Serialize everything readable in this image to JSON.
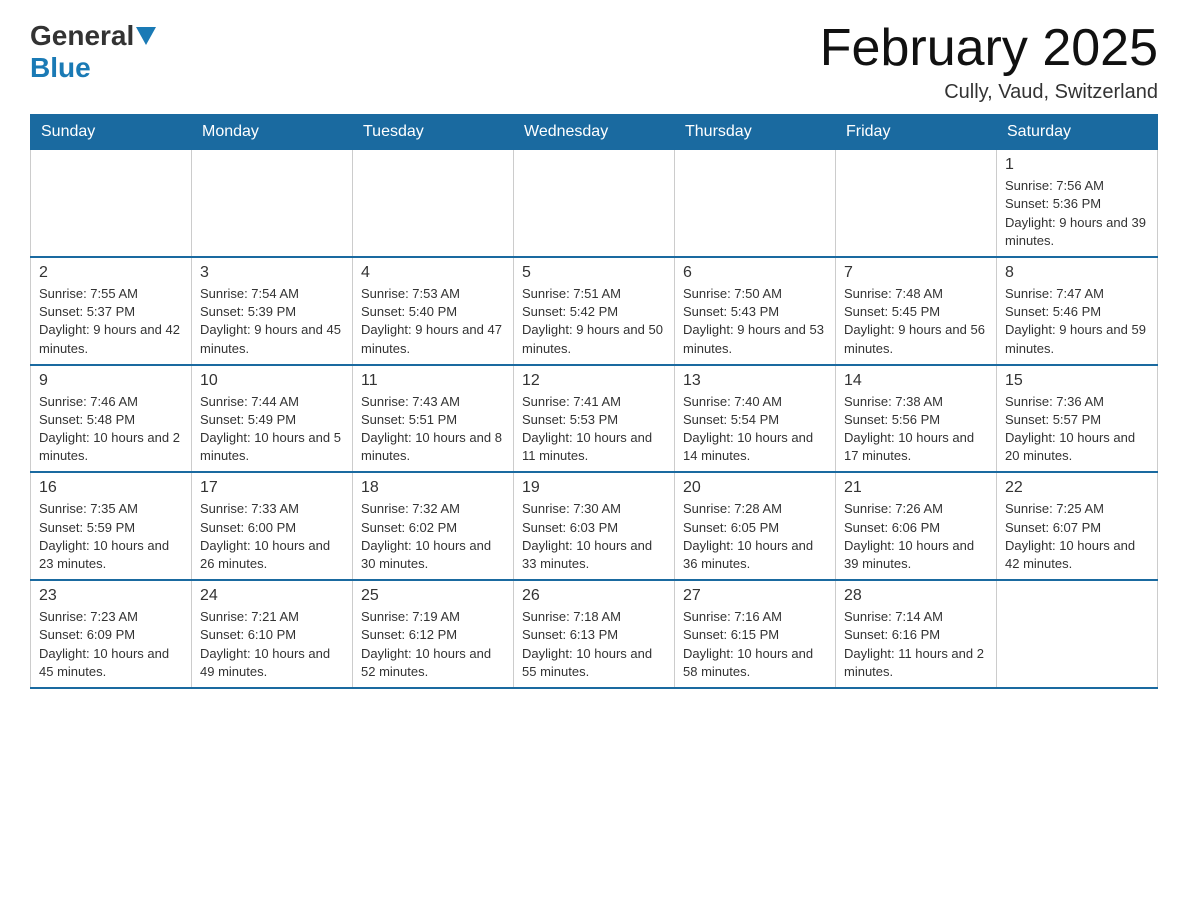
{
  "logo": {
    "general": "General",
    "blue": "Blue"
  },
  "header": {
    "title": "February 2025",
    "location": "Cully, Vaud, Switzerland"
  },
  "weekdays": [
    "Sunday",
    "Monday",
    "Tuesday",
    "Wednesday",
    "Thursday",
    "Friday",
    "Saturday"
  ],
  "weeks": [
    [
      {
        "day": "",
        "info": ""
      },
      {
        "day": "",
        "info": ""
      },
      {
        "day": "",
        "info": ""
      },
      {
        "day": "",
        "info": ""
      },
      {
        "day": "",
        "info": ""
      },
      {
        "day": "",
        "info": ""
      },
      {
        "day": "1",
        "info": "Sunrise: 7:56 AM\nSunset: 5:36 PM\nDaylight: 9 hours and 39 minutes."
      }
    ],
    [
      {
        "day": "2",
        "info": "Sunrise: 7:55 AM\nSunset: 5:37 PM\nDaylight: 9 hours and 42 minutes."
      },
      {
        "day": "3",
        "info": "Sunrise: 7:54 AM\nSunset: 5:39 PM\nDaylight: 9 hours and 45 minutes."
      },
      {
        "day": "4",
        "info": "Sunrise: 7:53 AM\nSunset: 5:40 PM\nDaylight: 9 hours and 47 minutes."
      },
      {
        "day": "5",
        "info": "Sunrise: 7:51 AM\nSunset: 5:42 PM\nDaylight: 9 hours and 50 minutes."
      },
      {
        "day": "6",
        "info": "Sunrise: 7:50 AM\nSunset: 5:43 PM\nDaylight: 9 hours and 53 minutes."
      },
      {
        "day": "7",
        "info": "Sunrise: 7:48 AM\nSunset: 5:45 PM\nDaylight: 9 hours and 56 minutes."
      },
      {
        "day": "8",
        "info": "Sunrise: 7:47 AM\nSunset: 5:46 PM\nDaylight: 9 hours and 59 minutes."
      }
    ],
    [
      {
        "day": "9",
        "info": "Sunrise: 7:46 AM\nSunset: 5:48 PM\nDaylight: 10 hours and 2 minutes."
      },
      {
        "day": "10",
        "info": "Sunrise: 7:44 AM\nSunset: 5:49 PM\nDaylight: 10 hours and 5 minutes."
      },
      {
        "day": "11",
        "info": "Sunrise: 7:43 AM\nSunset: 5:51 PM\nDaylight: 10 hours and 8 minutes."
      },
      {
        "day": "12",
        "info": "Sunrise: 7:41 AM\nSunset: 5:53 PM\nDaylight: 10 hours and 11 minutes."
      },
      {
        "day": "13",
        "info": "Sunrise: 7:40 AM\nSunset: 5:54 PM\nDaylight: 10 hours and 14 minutes."
      },
      {
        "day": "14",
        "info": "Sunrise: 7:38 AM\nSunset: 5:56 PM\nDaylight: 10 hours and 17 minutes."
      },
      {
        "day": "15",
        "info": "Sunrise: 7:36 AM\nSunset: 5:57 PM\nDaylight: 10 hours and 20 minutes."
      }
    ],
    [
      {
        "day": "16",
        "info": "Sunrise: 7:35 AM\nSunset: 5:59 PM\nDaylight: 10 hours and 23 minutes."
      },
      {
        "day": "17",
        "info": "Sunrise: 7:33 AM\nSunset: 6:00 PM\nDaylight: 10 hours and 26 minutes."
      },
      {
        "day": "18",
        "info": "Sunrise: 7:32 AM\nSunset: 6:02 PM\nDaylight: 10 hours and 30 minutes."
      },
      {
        "day": "19",
        "info": "Sunrise: 7:30 AM\nSunset: 6:03 PM\nDaylight: 10 hours and 33 minutes."
      },
      {
        "day": "20",
        "info": "Sunrise: 7:28 AM\nSunset: 6:05 PM\nDaylight: 10 hours and 36 minutes."
      },
      {
        "day": "21",
        "info": "Sunrise: 7:26 AM\nSunset: 6:06 PM\nDaylight: 10 hours and 39 minutes."
      },
      {
        "day": "22",
        "info": "Sunrise: 7:25 AM\nSunset: 6:07 PM\nDaylight: 10 hours and 42 minutes."
      }
    ],
    [
      {
        "day": "23",
        "info": "Sunrise: 7:23 AM\nSunset: 6:09 PM\nDaylight: 10 hours and 45 minutes."
      },
      {
        "day": "24",
        "info": "Sunrise: 7:21 AM\nSunset: 6:10 PM\nDaylight: 10 hours and 49 minutes."
      },
      {
        "day": "25",
        "info": "Sunrise: 7:19 AM\nSunset: 6:12 PM\nDaylight: 10 hours and 52 minutes."
      },
      {
        "day": "26",
        "info": "Sunrise: 7:18 AM\nSunset: 6:13 PM\nDaylight: 10 hours and 55 minutes."
      },
      {
        "day": "27",
        "info": "Sunrise: 7:16 AM\nSunset: 6:15 PM\nDaylight: 10 hours and 58 minutes."
      },
      {
        "day": "28",
        "info": "Sunrise: 7:14 AM\nSunset: 6:16 PM\nDaylight: 11 hours and 2 minutes."
      },
      {
        "day": "",
        "info": ""
      }
    ]
  ]
}
